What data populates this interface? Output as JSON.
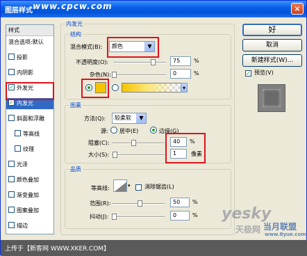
{
  "window": {
    "title": "图层样式",
    "watermark_top": "www.cpcw.com",
    "close_label": "×"
  },
  "style_list": {
    "header": "样式",
    "items": [
      {
        "label": "混合选项:默认",
        "checkbox": false,
        "checked": false,
        "selected": false
      },
      {
        "label": "投影",
        "checkbox": true,
        "checked": false,
        "selected": false
      },
      {
        "label": "内阴影",
        "checkbox": true,
        "checked": false,
        "selected": false
      },
      {
        "label": "外发光",
        "checkbox": true,
        "checked": true,
        "selected": false
      },
      {
        "label": "内发光",
        "checkbox": true,
        "checked": true,
        "selected": true
      },
      {
        "label": "斜面和浮雕",
        "checkbox": true,
        "checked": false,
        "selected": false
      },
      {
        "label": "等高线",
        "checkbox": true,
        "checked": false,
        "selected": false,
        "indent": true
      },
      {
        "label": "纹理",
        "checkbox": true,
        "checked": false,
        "selected": false,
        "indent": true
      },
      {
        "label": "光泽",
        "checkbox": true,
        "checked": false,
        "selected": false
      },
      {
        "label": "颜色叠加",
        "checkbox": true,
        "checked": false,
        "selected": false
      },
      {
        "label": "渐变叠加",
        "checkbox": true,
        "checked": false,
        "selected": false
      },
      {
        "label": "图案叠加",
        "checkbox": true,
        "checked": false,
        "selected": false
      },
      {
        "label": "描边",
        "checkbox": true,
        "checked": false,
        "selected": false
      }
    ]
  },
  "inner_glow": {
    "title": "内发光",
    "structure": {
      "title": "结构",
      "blend_mode_label": "混合模式(B):",
      "blend_mode_value": "颜色",
      "opacity_label": "不透明度(O):",
      "opacity_value": "75",
      "noise_label": "杂色(N):",
      "noise_value": "0",
      "percent": "%"
    },
    "elements": {
      "title": "图素",
      "technique_label": "方法(Q):",
      "technique_value": "较柔软",
      "source_label": "源:",
      "center_label": "居中(E)",
      "edge_label": "边缘(G)",
      "choke_label": "阻塞(C):",
      "choke_value": "40",
      "size_label": "大小(S):",
      "size_value": "1",
      "percent": "%",
      "px": "像素"
    },
    "quality": {
      "title": "品质",
      "contour_label": "等高线:",
      "antialias_label": "消除锯齿(L)",
      "range_label": "范围(R):",
      "range_value": "50",
      "jitter_label": "抖动(J):",
      "jitter_value": "0",
      "percent": "%"
    }
  },
  "buttons": {
    "ok": "好",
    "cancel": "取消",
    "new_style": "新建样式(W)...",
    "preview_label": "预览(V)"
  },
  "footer": {
    "text": "上传于【新客网 WWW.XKER.COM】"
  },
  "watermark": {
    "brand1": "yesky",
    "brand2": "天极网",
    "brand3": "当月联盟",
    "brand4": "www.8yue.com"
  },
  "colors": {
    "glow_color": "#f5c400",
    "highlight": "#e0101a",
    "selection": "#316ac5"
  }
}
